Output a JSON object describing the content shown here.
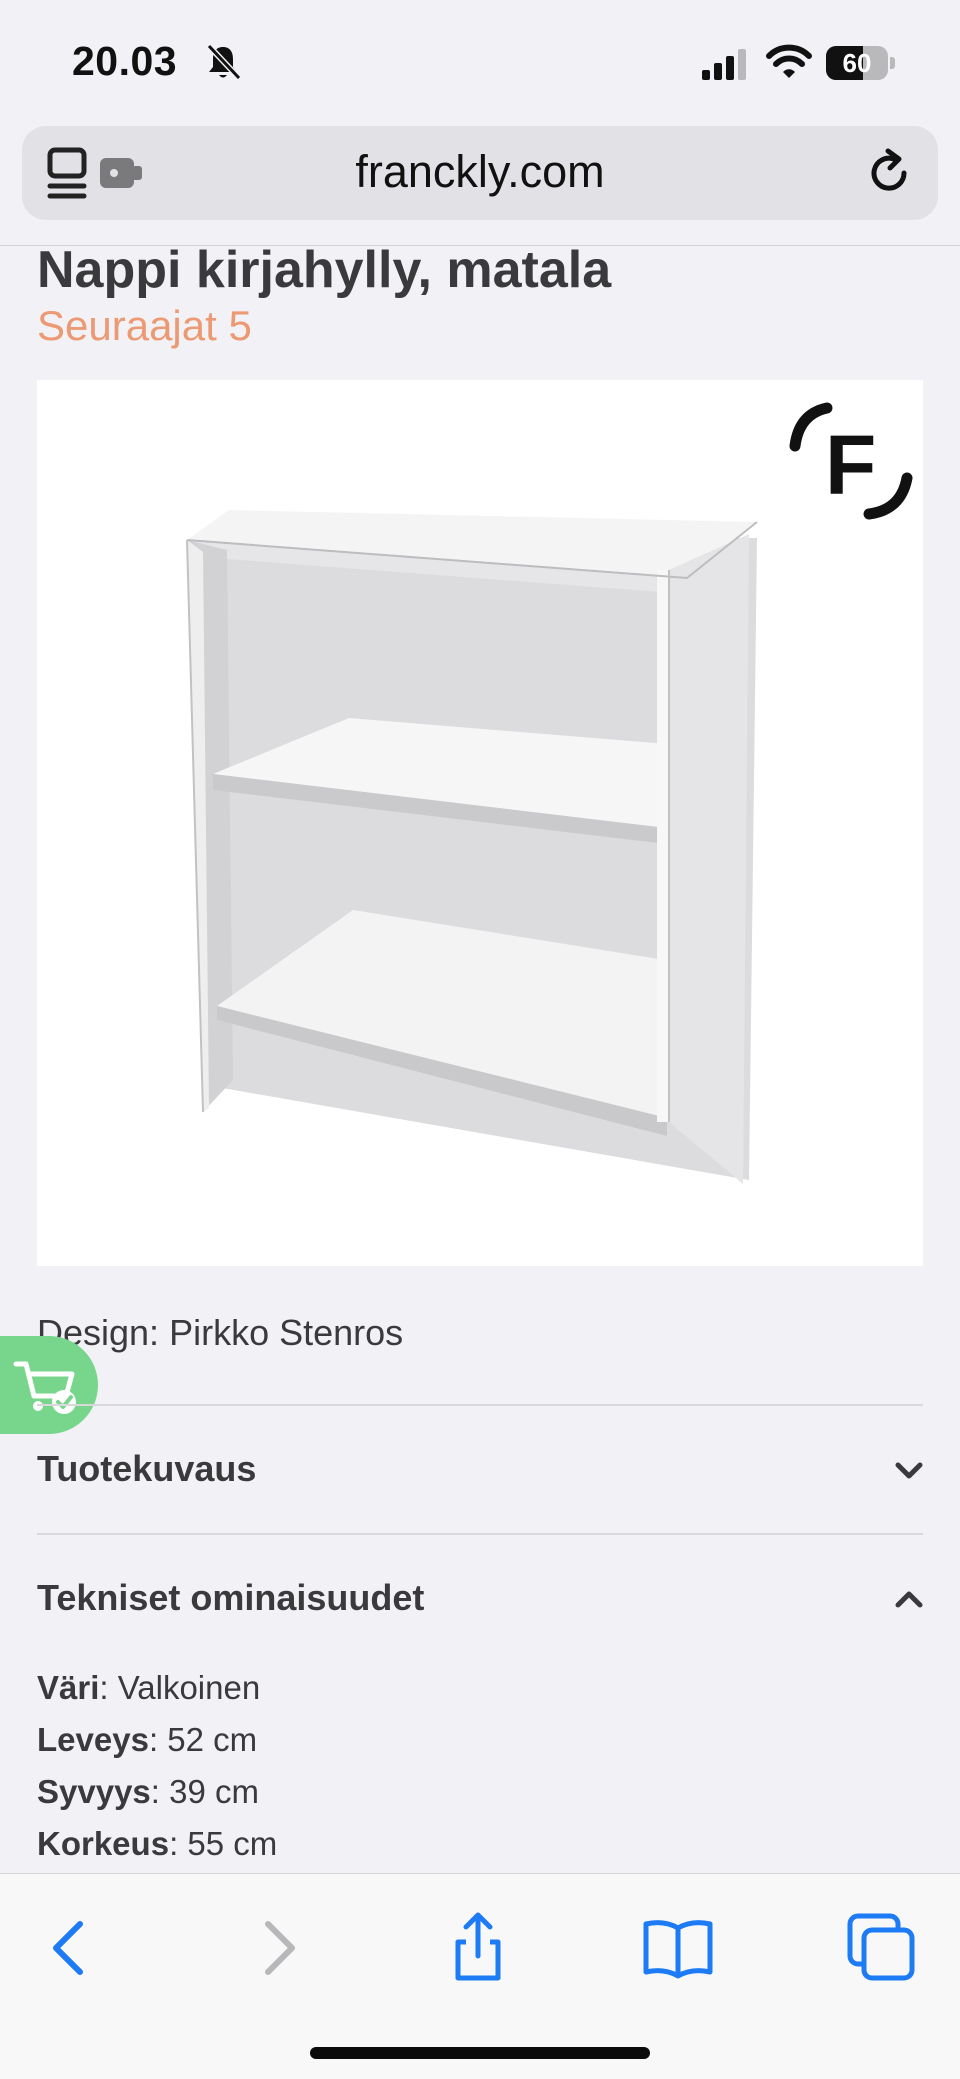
{
  "status_bar": {
    "time": "20.03",
    "battery_percent": "60",
    "battery_level": 0.6
  },
  "browser": {
    "url": "franckly.com"
  },
  "product": {
    "title": "Nappi kirjahylly, matala",
    "followers": "Seuraajat 5",
    "image_logo_letter": "F",
    "design": "Design: Pirkko Stenros"
  },
  "sections": {
    "description_label": "Tuotekuvaus",
    "description_state": "collapsed",
    "technical_label": "Tekniset ominaisuudet",
    "technical_state": "expanded"
  },
  "specs": [
    {
      "key": "Väri",
      "value": ": Valkoinen"
    },
    {
      "key": "Leveys",
      "value": ": 52 cm"
    },
    {
      "key": "Syvyys",
      "value": ": 39 cm"
    },
    {
      "key": "Korkeus",
      "value": ": 55 cm"
    }
  ],
  "colors": {
    "accent": "#ec9a74",
    "link_blue": "#1d7bf5",
    "cart_green": "#78d68c",
    "text": "#3a3a3c"
  },
  "toolbar": {
    "icons": [
      "back-icon",
      "forward-icon",
      "share-icon",
      "bookmarks-icon",
      "tabs-icon"
    ]
  }
}
